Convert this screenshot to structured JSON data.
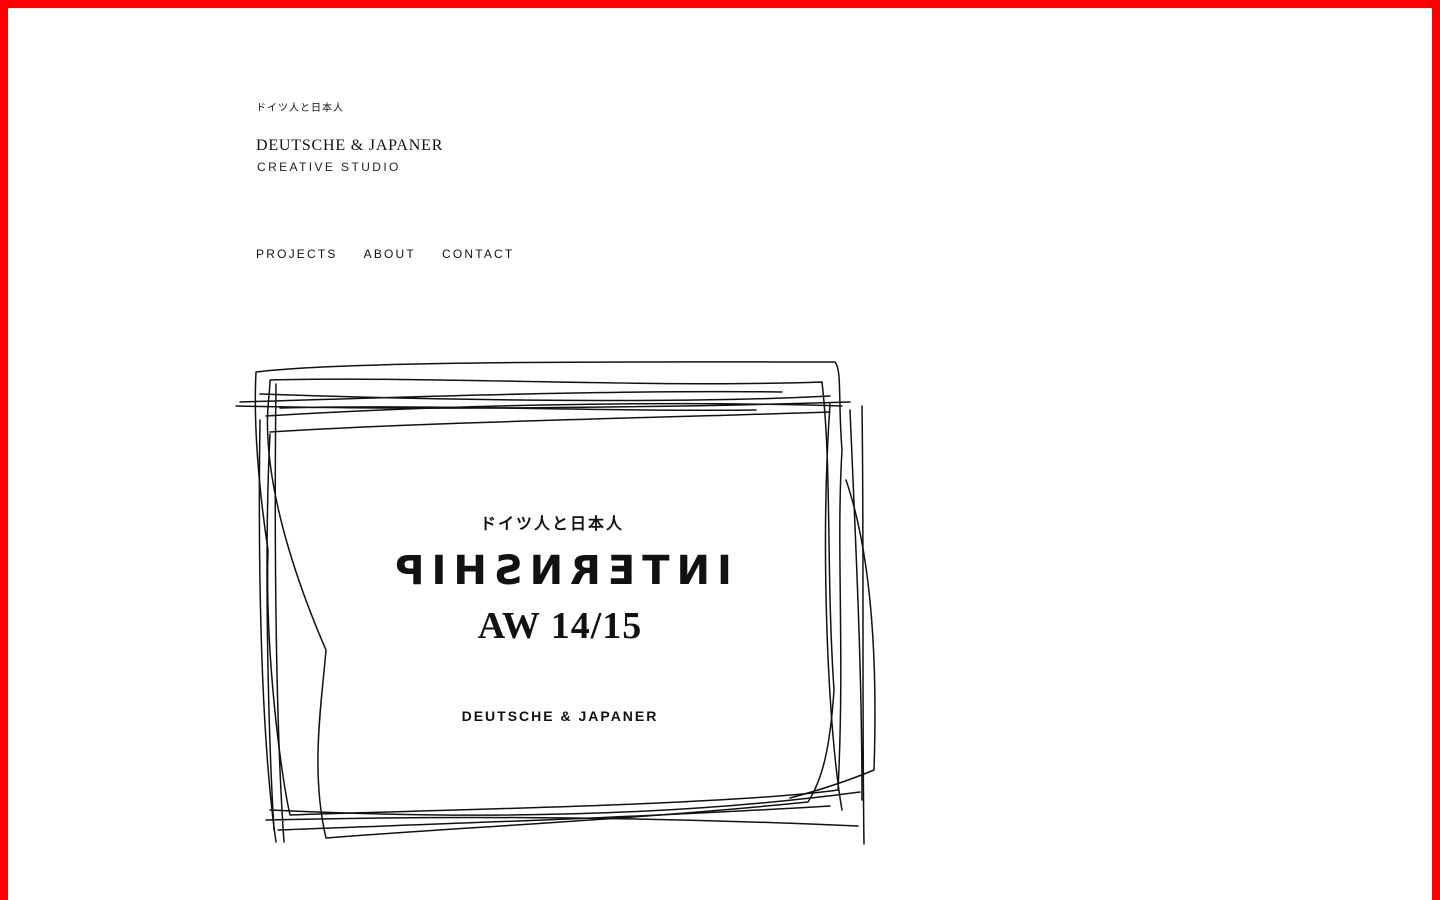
{
  "header": {
    "brand_japanese": "ドイツ人と日本人",
    "brand_name": "DEUTSCHE & JAPANER",
    "brand_subtitle": "CREATIVE STUDIO"
  },
  "nav": {
    "items": [
      {
        "label": "PROJECTS"
      },
      {
        "label": "ABOUT"
      },
      {
        "label": "CONTACT"
      }
    ]
  },
  "artwork": {
    "japanese": "ドイツ人と日本人",
    "title": "INTERNSHIP",
    "season": "AW 14/15",
    "brand": "DEUTSCHE & JAPANER"
  },
  "colors": {
    "frame": "#ff0000",
    "text": "#111111",
    "background": "#ffffff"
  }
}
